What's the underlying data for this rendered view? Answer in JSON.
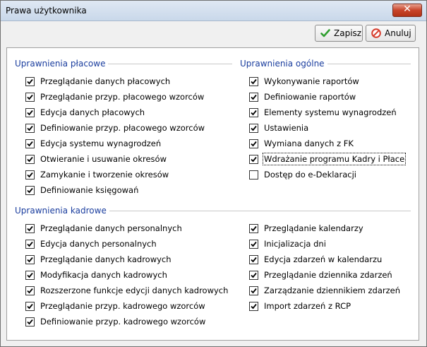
{
  "window": {
    "title": "Prawa użytkownika",
    "close_symbol": "✕"
  },
  "toolbar": {
    "save_label": "Zapisz",
    "cancel_label": "Anuluj"
  },
  "colors": {
    "group_title": "#1a3d9e",
    "save_icon": "#2e9e2e",
    "cancel_icon": "#d63a2a"
  },
  "groups": {
    "placowe": {
      "title": "Uprawnienia płacowe",
      "items": [
        {
          "label": "Przeglądanie danych płacowych",
          "checked": true
        },
        {
          "label": "Przeglądanie przyp. płacowego wzorców",
          "checked": true
        },
        {
          "label": "Edycja danych płacowych",
          "checked": true
        },
        {
          "label": "Definiowanie przyp. płacowego wzorców",
          "checked": true
        },
        {
          "label": "Edycja systemu wynagrodzeń",
          "checked": true
        },
        {
          "label": "Otwieranie i usuwanie okresów",
          "checked": true
        },
        {
          "label": "Zamykanie i tworzenie okresów",
          "checked": true
        },
        {
          "label": "Definiowanie księgowań",
          "checked": true
        }
      ]
    },
    "ogolne": {
      "title": "Uprawnienia ogólne",
      "items": [
        {
          "label": "Wykonywanie raportów",
          "checked": true
        },
        {
          "label": "Definiowanie raportów",
          "checked": true
        },
        {
          "label": "Elementy systemu wynagrodzeń",
          "checked": true
        },
        {
          "label": "Ustawienia",
          "checked": true
        },
        {
          "label": "Wymiana danych z FK",
          "checked": true
        },
        {
          "label": "Wdrażanie programu Kadry i Płace",
          "checked": true,
          "focused": true
        },
        {
          "label": "Dostęp do e-Deklaracji",
          "checked": false
        }
      ]
    },
    "kadrowe": {
      "title": "Uprawnienia kadrowe",
      "left": [
        {
          "label": "Przeglądanie danych personalnych",
          "checked": true
        },
        {
          "label": "Edycja danych personalnych",
          "checked": true
        },
        {
          "label": "Przeglądanie danych kadrowych",
          "checked": true
        },
        {
          "label": "Modyfikacja danych kadrowych",
          "checked": true
        },
        {
          "label": "Rozszerzone funkcje edycji danych kadrowych",
          "checked": true
        },
        {
          "label": "Przeglądanie przyp. kadrowego wzorców",
          "checked": true
        },
        {
          "label": "Definiowanie przyp. kadrowego wzorców",
          "checked": true
        }
      ],
      "right": [
        {
          "label": "Przeglądanie kalendarzy",
          "checked": true
        },
        {
          "label": "Inicjalizacja dni",
          "checked": true
        },
        {
          "label": "Edycja zdarzeń w kalendarzu",
          "checked": true
        },
        {
          "label": "Przeglądanie dziennika zdarzeń",
          "checked": true
        },
        {
          "label": "Zarządzanie dziennikiem zdarzeń",
          "checked": true
        },
        {
          "label": "Import zdarzeń z RCP",
          "checked": true
        }
      ]
    }
  }
}
